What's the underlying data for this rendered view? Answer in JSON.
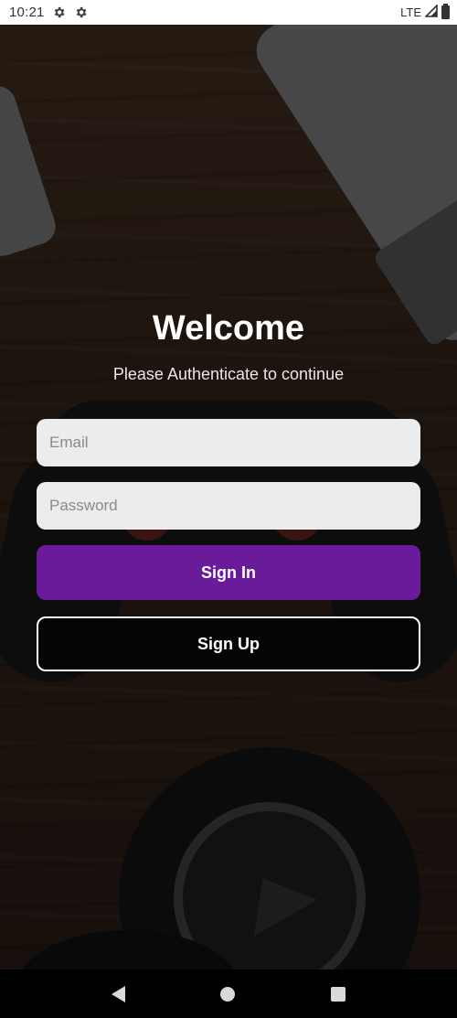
{
  "status_bar": {
    "time": "10:21",
    "network": "LTE",
    "icons": [
      "gear-icon",
      "gear-icon",
      "signal-icon",
      "battery-icon"
    ]
  },
  "auth": {
    "title": "Welcome",
    "subtitle": "Please Authenticate to continue",
    "email_placeholder": "Email",
    "email_value": "",
    "password_placeholder": "Password",
    "password_value": "",
    "sign_in_label": "Sign In",
    "sign_up_label": "Sign Up"
  },
  "colors": {
    "primary": "#6a1b9a",
    "field_bg": "#ececec",
    "secondary_button_bg": "#050505"
  },
  "nav_bar": {
    "icons": [
      "back-icon",
      "home-icon",
      "recents-icon"
    ]
  }
}
